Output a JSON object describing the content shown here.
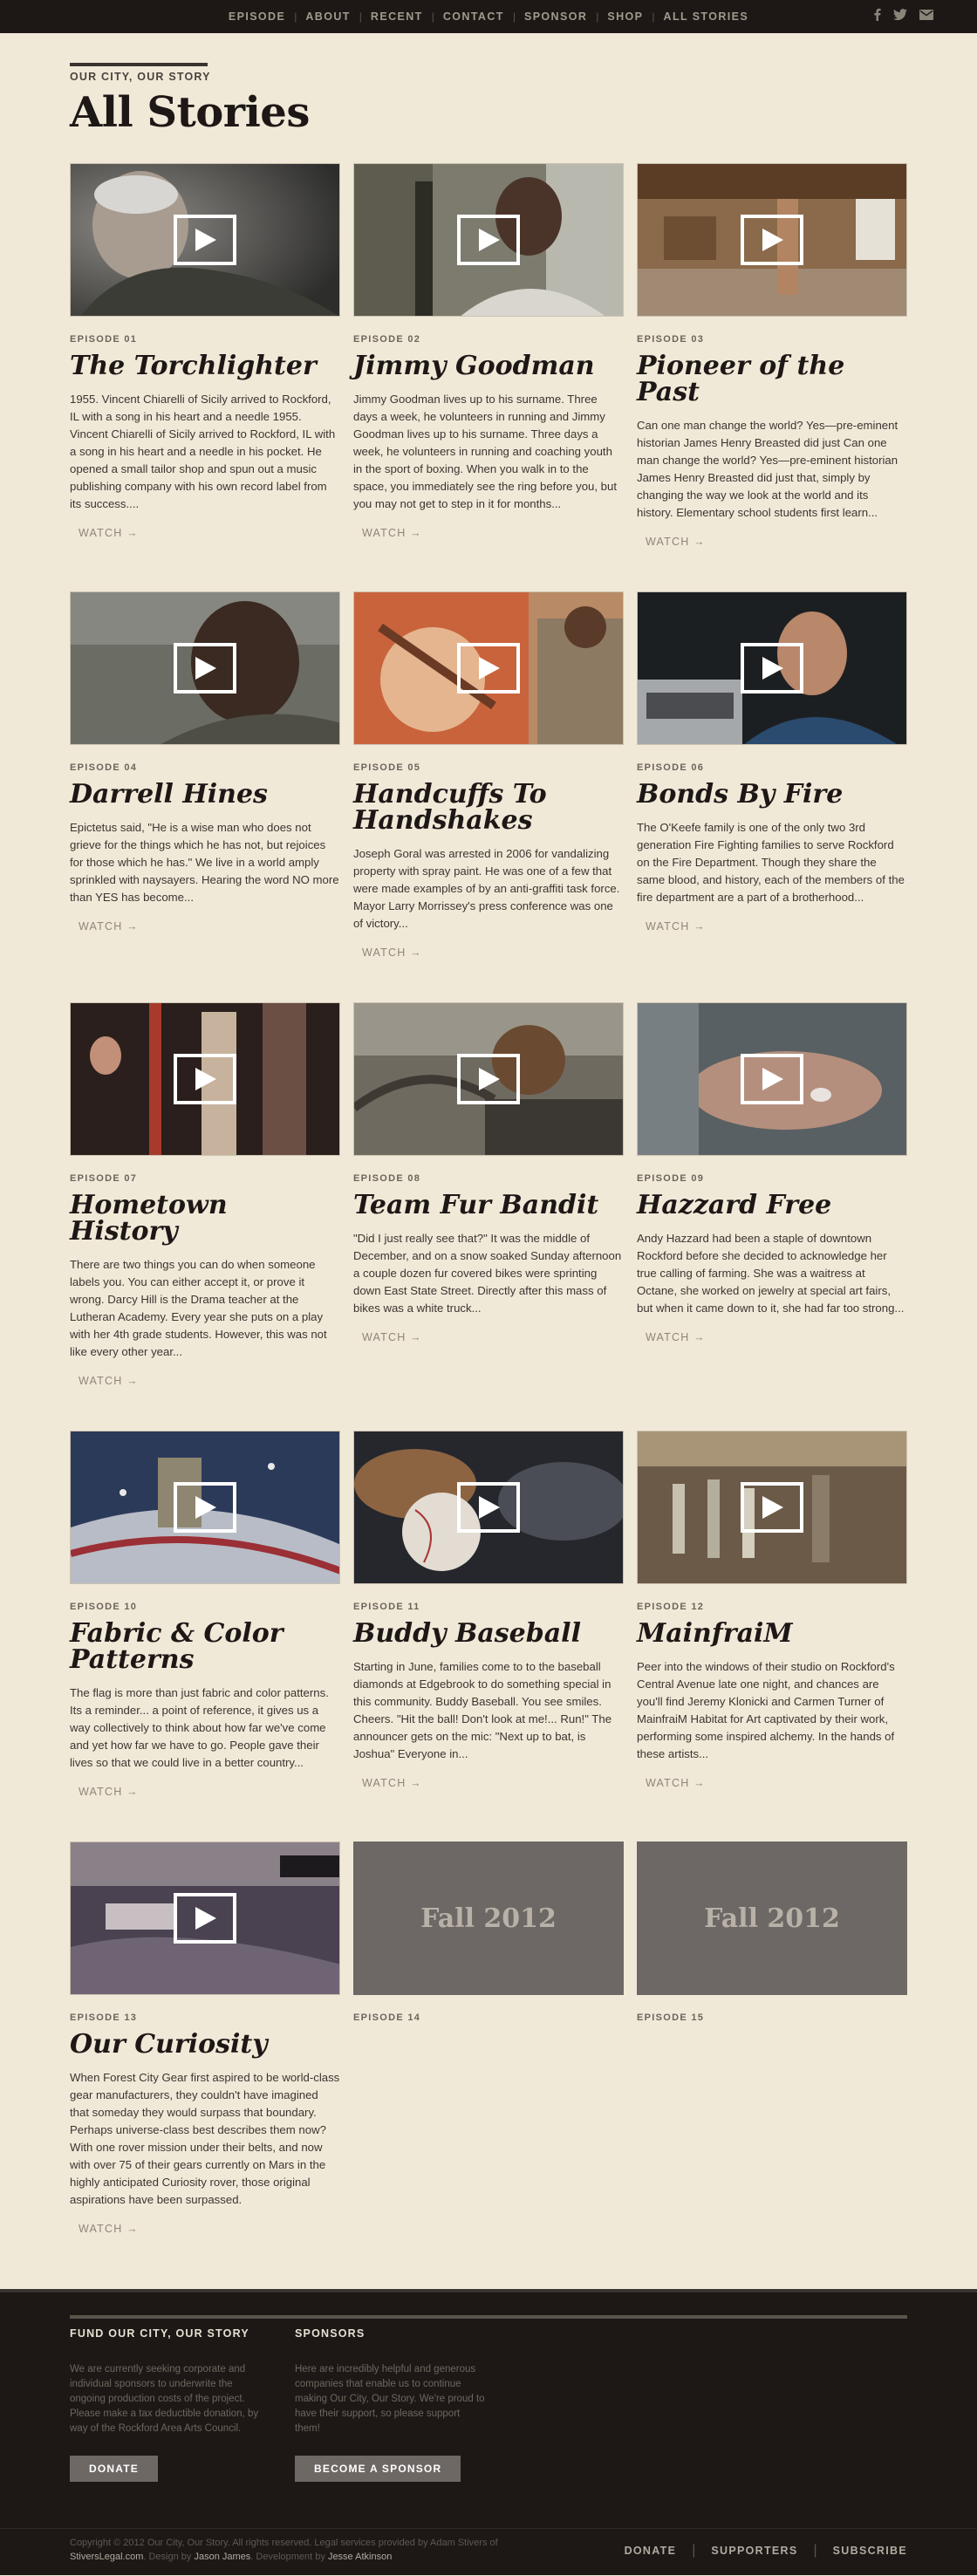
{
  "nav": {
    "items": [
      "EPISODE",
      "ABOUT",
      "RECENT",
      "CONTACT",
      "SPONSOR",
      "SHOP",
      "ALL STORIES"
    ],
    "separator": "|",
    "social_icons": [
      "facebook-icon",
      "twitter-icon",
      "email-icon"
    ]
  },
  "header": {
    "eyebrow": "OUR CITY, OUR STORY",
    "title": "All Stories"
  },
  "watch_label": "WATCH →",
  "episodes": [
    {
      "ep": "EPISODE 01",
      "title": "The Torchlighter",
      "desc": "1955. Vincent Chiarelli of Sicily arrived to Rockford, IL with a song in his heart and a needle 1955. Vincent Chiarelli of Sicily arrived to Rockford, IL with a song in his heart and a needle in his pocket. He opened a small tailor shop and spun out a music publishing company with his own record label from its success....",
      "scene": "elder"
    },
    {
      "ep": "EPISODE 02",
      "title": "Jimmy Goodman",
      "desc": "Jimmy Goodman lives up to his surname. Three days a week, he volunteers in running and Jimmy Goodman lives up to his surname. Three days a week, he volunteers in running and coaching youth in the sport of boxing. When you walk in to the space, you immediately see the ring before you, but you may not get to step in it for months...",
      "scene": "boxing"
    },
    {
      "ep": "EPISODE 03",
      "title": "Pioneer of the Past",
      "desc": "Can one man change the world? Yes—pre-eminent historian James Henry Breasted did just Can one man change the world? Yes—pre-eminent historian James Henry Breasted did just that, simply by changing the way we look at the world and its history. Elementary school students first learn...",
      "scene": "museum"
    },
    {
      "ep": "EPISODE 04",
      "title": "Darrell Hines",
      "desc": "Epictetus said, \"He is a wise man who does not grieve for the things which he has not, but rejoices for those which he has.\" We live in a world amply sprinkled with naysayers. Hearing the word NO more than YES has become...",
      "scene": "portrait"
    },
    {
      "ep": "EPISODE 05",
      "title": "Handcuffs To Handshakes",
      "desc": "Joseph Goral was arrested in 2006 for vandalizing property with spray paint. He was one of a few that were made examples of by an anti-graffiti task force. Mayor Larry Morrissey's press conference was one of victory...",
      "scene": "painter"
    },
    {
      "ep": "EPISODE 06",
      "title": "Bonds By Fire",
      "desc": "The O'Keefe family is one of the only two 3rd generation Fire Fighting families to serve Rockford on the Fire Department. Though they share the same blood, and history, each of the members of the fire department are a part of a brotherhood...",
      "scene": "fire"
    },
    {
      "ep": "EPISODE 07",
      "title": "Hometown History",
      "desc": "There are two things you can do when someone labels you. You can either accept it, or prove it wrong. Darcy Hill is the Drama teacher at the Lutheran Academy. Every year she puts on a play with her 4th grade students. However, this was not like every other year...",
      "scene": "stage"
    },
    {
      "ep": "EPISODE 08",
      "title": "Team Fur Bandit",
      "desc": "\"Did I just really see that?\" It was the middle of December, and on a snow soaked Sunday afternoon a couple dozen fur covered bikes were sprinting down East State Street. Directly after this mass of bikes was a white truck...",
      "scene": "bike"
    },
    {
      "ep": "EPISODE 09",
      "title": "Hazzard Free",
      "desc": "Andy Hazzard had been a staple of downtown Rockford before she decided to acknowledge her true calling of farming. She was a waitress at Octane, she worked on jewelry at special art fairs, but when it came down to it, she had far too strong...",
      "scene": "hands"
    },
    {
      "ep": "EPISODE 10",
      "title": "Fabric & Color Patterns",
      "desc": "The flag is more than just fabric and color patterns. Its a reminder... a point of reference, it gives us a way collectively to think about how far we've come and yet how far we have to go. People gave their lives so that we could live in a better country...",
      "scene": "flag"
    },
    {
      "ep": "EPISODE 11",
      "title": "Buddy Baseball",
      "desc": "Starting in June, families come to to the baseball diamonds at Edgebrook to do something special in this community. Buddy Baseball. You see smiles. Cheers. \"Hit the ball! Don't look at me!... Run!\" The announcer gets on the mic: \"Next up to bat, is Joshua\" Everyone in...",
      "scene": "baseball"
    },
    {
      "ep": "EPISODE 12",
      "title": "MainfraiM",
      "desc": "Peer into the windows of their studio on Rockford's Central Avenue late one night, and chances are you'll find Jeremy Klonicki and Carmen Turner of MainfraiM Habitat for Art captivated by their work, performing some inspired alchemy. In the hands of these artists...",
      "scene": "glass"
    },
    {
      "ep": "EPISODE 13",
      "title": "Our Curiosity",
      "desc": "When Forest City Gear first aspired to be world-class gear manufacturers, they couldn't have imagined that someday they would surpass that boundary. Perhaps universe-class best describes them now? With one rover mission under their belts, and now with over 75 of their gears currently on Mars in the highly anticipated Curiosity rover, those original aspirations have been surpassed.",
      "scene": "rover"
    },
    {
      "ep": "EPISODE 14",
      "title": "",
      "desc": "",
      "placeholder": "Fall 2012"
    },
    {
      "ep": "EPISODE 15",
      "title": "",
      "desc": "",
      "placeholder": "Fall 2012"
    }
  ],
  "footer": {
    "fund": {
      "heading": "FUND OUR CITY, OUR STORY",
      "text": "We are currently seeking corporate and individual sponsors to underwrite the ongoing production costs of the project. Please make a tax deductible donation, by way of the Rockford Area Arts Council.",
      "button": "DONATE"
    },
    "sponsors": {
      "heading": "SPONSORS",
      "text": "Here are incredibly helpful and generous companies that enable us to continue making Our City, Our Story. We're proud to have their support, so please support them!",
      "button": "BECOME A SPONSOR"
    },
    "copyright": "Copyright © 2012 Our City, Our Story. All rights reserved. Legal services provided by Adam Stivers of",
    "legal_link": "StiversLegal.com",
    "design_by": ". Design by ",
    "designer": "Jason James",
    "dev_by": ". Development by ",
    "developer": "Jesse Atkinson",
    "links": [
      "DONATE",
      "SUPPORTERS",
      "SUBSCRIBE"
    ]
  }
}
